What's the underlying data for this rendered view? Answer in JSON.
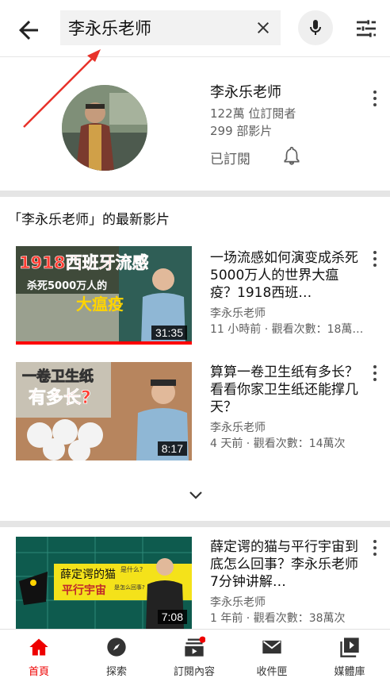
{
  "search": {
    "query": "李永乐老师"
  },
  "channel": {
    "name": "李永乐老师",
    "subscribers": "122萬 位訂閱者",
    "videos": "299 部影片",
    "subscribed_label": "已訂閱"
  },
  "section": {
    "title": "「李永乐老师」的最新影片"
  },
  "videos": [
    {
      "title": "一场流感如何演变成杀死5000万人的世界大瘟疫？1918西班…",
      "channel": "李永乐老师",
      "meta": "11 小時前 · 觀看次數：18萬…",
      "duration": "31:35",
      "thumb_text1": "1918西班牙流感",
      "thumb_text2": "杀死5000万人的",
      "thumb_text3": "大瘟疫"
    },
    {
      "title": "算算一卷卫生纸有多长？看看你家卫生纸还能撑几天？",
      "channel": "李永乐老师",
      "meta": "4 天前 · 觀看次數：14萬次",
      "duration": "8:17",
      "thumb_text1": "一卷卫生纸",
      "thumb_text2": "有多长?"
    },
    {
      "title": "薛定谔的猫与平行宇宙到底怎么回事？李永乐老师7分钟讲解…",
      "channel": "李永乐老师",
      "meta": "1 年前 · 觀看次數：38萬次",
      "duration": "7:08",
      "thumb_text1": "薛定谔的猫",
      "thumb_text2": "平行宇宙",
      "thumb_text3": "是什么?",
      "thumb_text4": "是怎么回事?"
    }
  ],
  "nav": [
    {
      "label": "首頁",
      "icon": "home-icon",
      "active": true
    },
    {
      "label": "探索",
      "icon": "explore-icon"
    },
    {
      "label": "訂閱內容",
      "icon": "subscriptions-icon"
    },
    {
      "label": "收件匣",
      "icon": "inbox-icon"
    },
    {
      "label": "媒體庫",
      "icon": "library-icon"
    }
  ],
  "colors": {
    "accent": "#ff0000",
    "secondary_text": "#606060"
  }
}
